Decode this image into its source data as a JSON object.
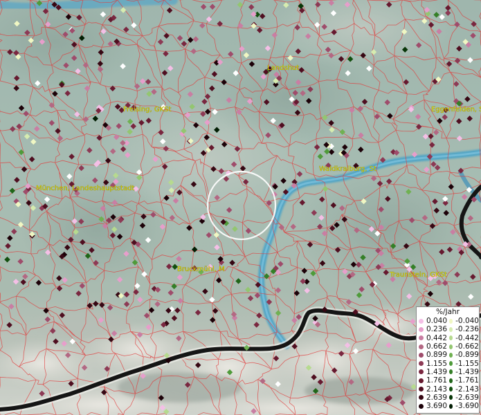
{
  "map": {
    "places": [
      {
        "name": "Landshut"
      },
      {
        "name": "Freising, GKSt"
      },
      {
        "name": "Eggenfelden, St"
      },
      {
        "name": "Waldkraiburg, St"
      },
      {
        "name": "München, Landeshauptstadt"
      },
      {
        "name": "Bruckmühl, M"
      },
      {
        "name": "Traunstein, GKSt"
      }
    ],
    "legend": {
      "title": "%/Jahr",
      "positive": [
        {
          "label": "0.040",
          "color": "#f4bfe6"
        },
        {
          "label": "0.236",
          "color": "#e79ecb"
        },
        {
          "label": "0.442",
          "color": "#c97ea3"
        },
        {
          "label": "0.662",
          "color": "#b36883"
        },
        {
          "label": "0.899",
          "color": "#9f4c6b"
        },
        {
          "label": "1.155",
          "color": "#8d3a55"
        },
        {
          "label": "1.439",
          "color": "#7a2740"
        },
        {
          "label": "1.761",
          "color": "#66192f"
        },
        {
          "label": "2.143",
          "color": "#4f0e20"
        },
        {
          "label": "2.639",
          "color": "#360713"
        },
        {
          "label": "3.690",
          "color": "#1c0108"
        }
      ],
      "negative": [
        {
          "label": "-0.040",
          "color": "#f0f7c3"
        },
        {
          "label": "-0.236",
          "color": "#d6ecb0"
        },
        {
          "label": "-0.442",
          "color": "#b6da8f"
        },
        {
          "label": "-0.662",
          "color": "#93c670"
        },
        {
          "label": "-0.899",
          "color": "#70b152"
        },
        {
          "label": "-1.155",
          "color": "#4f9b3a"
        },
        {
          "label": "-1.439",
          "color": "#347f27"
        },
        {
          "label": "-1.761",
          "color": "#206619"
        },
        {
          "label": "-2.143",
          "color": "#124f0f"
        },
        {
          "label": "-2.639",
          "color": "#073607"
        },
        {
          "label": "-3.690",
          "color": "#011d02"
        }
      ]
    }
  }
}
